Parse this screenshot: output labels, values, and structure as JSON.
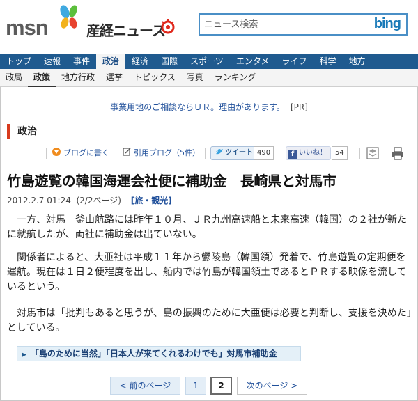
{
  "header": {
    "msn_logo": "msn",
    "sankei_logo": "産経ニュース",
    "search_placeholder": "ニュース検索",
    "search_engine": "bing"
  },
  "nav": {
    "items": [
      "トップ",
      "速報",
      "事件",
      "政治",
      "経済",
      "国際",
      "スポーツ",
      "エンタメ",
      "ライフ",
      "科学",
      "地方"
    ],
    "active_index": 3
  },
  "subnav": {
    "items": [
      "政局",
      "政策",
      "地方行政",
      "選挙",
      "トピックス",
      "写真",
      "ランキング"
    ],
    "active_index": 1
  },
  "ad": {
    "text": "事業用地のご相談ならＵＲ。理由があります。",
    "tag": "[PR]"
  },
  "section": {
    "title": "政治"
  },
  "social": {
    "blog_write": "ブログに書く",
    "quote_blog": "引用ブログ（5件）",
    "tweet": "ツイート",
    "tweet_count": "490",
    "like": "いいね！",
    "like_count": "54"
  },
  "article": {
    "headline": "竹島遊覧の韓国海運会社便に補助金　長崎県と対馬市",
    "date": "2012.2.7 01:24",
    "page": "(2/2ページ)",
    "category": "[旅・観光]",
    "paragraphs": [
      "一方、対馬－釜山航路には昨年１０月、ＪＲ九州高速船と未来高速（韓国）の２社が新たに就航したが、両社に補助金は出ていない。",
      "関係者によると、大亜社は平成１１年から鬱陵島（韓国領）発着で、竹島遊覧の定期便を運航。現在は１日２便程度を出し、船内では竹島が韓国領土であるとＰＲする映像を流しているという。",
      "対馬市は「批判もあると思うが、島の振興のために大亜便は必要と判断し、支援を決めた」としている。"
    ],
    "related": "「島のために当然」「日本人が来てくれるわけでも」対馬市補助金"
  },
  "pager": {
    "prev": "< 前のページ",
    "page1": "1",
    "page2": "2",
    "next": "次のページ >"
  },
  "colors": {
    "nav_bg": "#1f5a8f",
    "section_accent": "#d83b1e",
    "link": "#1f4f9a"
  }
}
